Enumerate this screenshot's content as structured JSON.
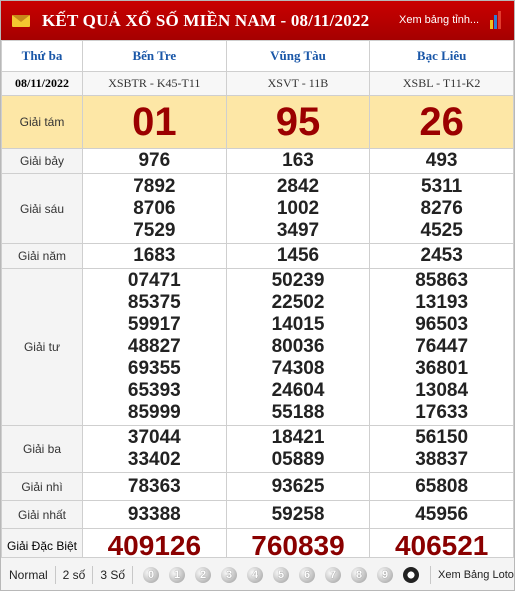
{
  "header": {
    "title": "KẾT QUẢ XỔ SỐ MIỀN NAM - 08/11/2022",
    "link": "Xem bảng tỉnh..."
  },
  "columns": {
    "weekday": "Thứ ba",
    "date": "08/11/2022",
    "provinces": [
      {
        "name": "Bến Tre",
        "code": "XSBTR - K45-T11"
      },
      {
        "name": "Vũng Tàu",
        "code": "XSVT - 11B"
      },
      {
        "name": "Bạc Liêu",
        "code": "XSBL - T11-K2"
      }
    ]
  },
  "prizes": [
    {
      "label": "Giải tám",
      "values": [
        [
          "01"
        ],
        [
          "95"
        ],
        [
          "26"
        ]
      ]
    },
    {
      "label": "Giải bảy",
      "values": [
        [
          "976"
        ],
        [
          "163"
        ],
        [
          "493"
        ]
      ]
    },
    {
      "label": "Giải sáu",
      "values": [
        [
          "7892",
          "8706",
          "7529"
        ],
        [
          "2842",
          "1002",
          "3497"
        ],
        [
          "5311",
          "8276",
          "4525"
        ]
      ]
    },
    {
      "label": "Giải năm",
      "values": [
        [
          "1683"
        ],
        [
          "1456"
        ],
        [
          "2453"
        ]
      ]
    },
    {
      "label": "Giải tư",
      "values": [
        [
          "07471",
          "85375",
          "59917",
          "48827",
          "69355",
          "65393",
          "85999"
        ],
        [
          "50239",
          "22502",
          "14015",
          "80036",
          "74308",
          "24604",
          "55188"
        ],
        [
          "85863",
          "13193",
          "96503",
          "76447",
          "36801",
          "13084",
          "17633"
        ]
      ]
    },
    {
      "label": "Giải ba",
      "values": [
        [
          "37044",
          "33402"
        ],
        [
          "18421",
          "05889"
        ],
        [
          "56150",
          "38837"
        ]
      ]
    },
    {
      "label": "Giải nhì",
      "values": [
        [
          "78363"
        ],
        [
          "93625"
        ],
        [
          "65808"
        ]
      ]
    },
    {
      "label": "Giải nhất",
      "values": [
        [
          "93388"
        ],
        [
          "59258"
        ],
        [
          "45956"
        ]
      ]
    },
    {
      "label": "Giải Đặc Biệt",
      "values": [
        [
          "409126"
        ],
        [
          "760839"
        ],
        [
          "406521"
        ]
      ]
    }
  ],
  "footer": {
    "modes": [
      "Normal",
      "2 số",
      "3 Số"
    ],
    "digits": [
      "0",
      "1",
      "2",
      "3",
      "4",
      "5",
      "6",
      "7",
      "8",
      "9"
    ],
    "link": "Xem Bảng Loto"
  },
  "colors": {
    "header_red": "#b80000",
    "highlight_row": "#fde7a6",
    "special_prize": "#8a0000",
    "province_blue": "#1a57a8"
  }
}
